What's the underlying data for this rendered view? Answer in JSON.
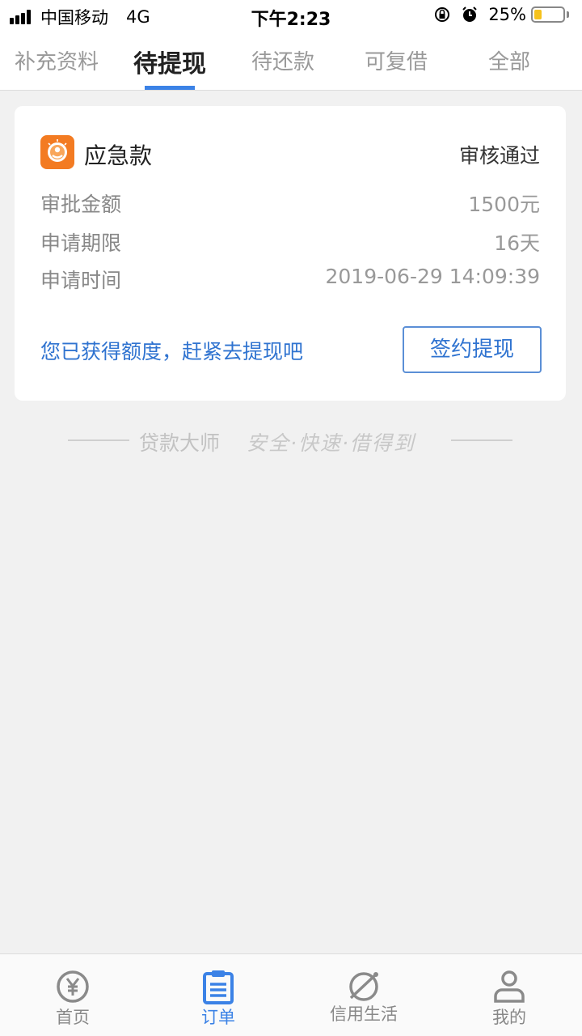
{
  "status_bar": {
    "carrier": "中国移动",
    "network": "4G",
    "time": "下午2:23",
    "battery": "25%",
    "battery_level": 0.25
  },
  "tabs": [
    {
      "label": "补充资料",
      "active": false
    },
    {
      "label": "待提现",
      "active": true
    },
    {
      "label": "待还款",
      "active": false
    },
    {
      "label": "可复借",
      "active": false
    },
    {
      "label": "全部",
      "active": false
    }
  ],
  "order": {
    "app_name": "应急款",
    "status": "审核通过",
    "rows": [
      {
        "label": "审批金额",
        "value": "1500元"
      },
      {
        "label": "申请期限",
        "value": "16天"
      },
      {
        "label": "申请时间",
        "value": "2019-06-29 14:09:39"
      }
    ],
    "promo": "您已获得额度，赶紧去提现吧",
    "action_label": "签约提现"
  },
  "slogan": {
    "brand": "贷款大师",
    "motto": "安全·快速·借得到"
  },
  "bottom_nav": [
    {
      "label": "首页",
      "icon": "yen-icon",
      "active": false
    },
    {
      "label": "订单",
      "icon": "order-clipboard-icon",
      "active": true
    },
    {
      "label": "信用生活",
      "icon": "planet-icon",
      "active": false
    },
    {
      "label": "我的",
      "icon": "user-icon",
      "active": false
    }
  ],
  "colors": {
    "accent": "#3b82e6",
    "logo": "#f37b22",
    "battery": "#f6c21c"
  }
}
